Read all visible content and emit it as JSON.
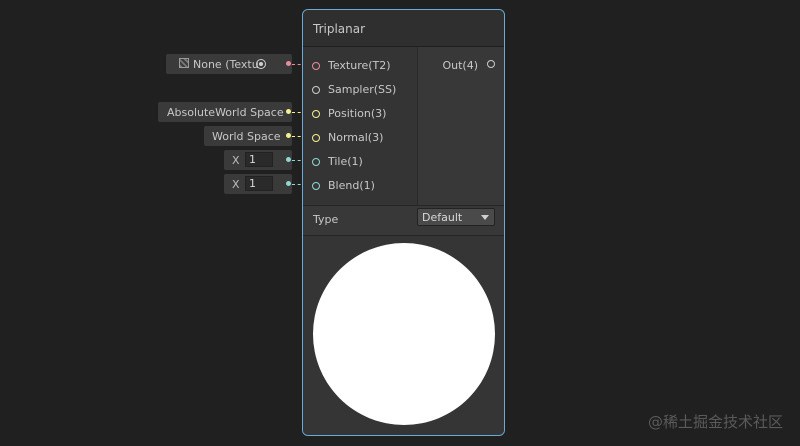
{
  "node": {
    "title": "Triplanar",
    "inputs": [
      {
        "label": "Texture(T2)",
        "color": "#e98c9a"
      },
      {
        "label": "Sampler(SS)",
        "color": "#cccccc"
      },
      {
        "label": "Position(3)",
        "color": "#f6ef8f"
      },
      {
        "label": "Normal(3)",
        "color": "#f6ef8f"
      },
      {
        "label": "Tile(1)",
        "color": "#8fd8d2"
      },
      {
        "label": "Blend(1)",
        "color": "#8fd8d2"
      }
    ],
    "output": {
      "label": "Out(4)"
    },
    "type_label": "Type",
    "type_value": "Default"
  },
  "slots": {
    "texture_value": "None (Textu",
    "position_value": "AbsoluteWorld Space",
    "normal_value": "World Space",
    "tile_axis": "X",
    "tile_value": "1",
    "blend_axis": "X",
    "blend_value": "1"
  },
  "watermark": "@稀土掘金技术社区",
  "icons": [
    "texture-icon",
    "object-picker-icon",
    "dropdown-arrow-icon"
  ]
}
